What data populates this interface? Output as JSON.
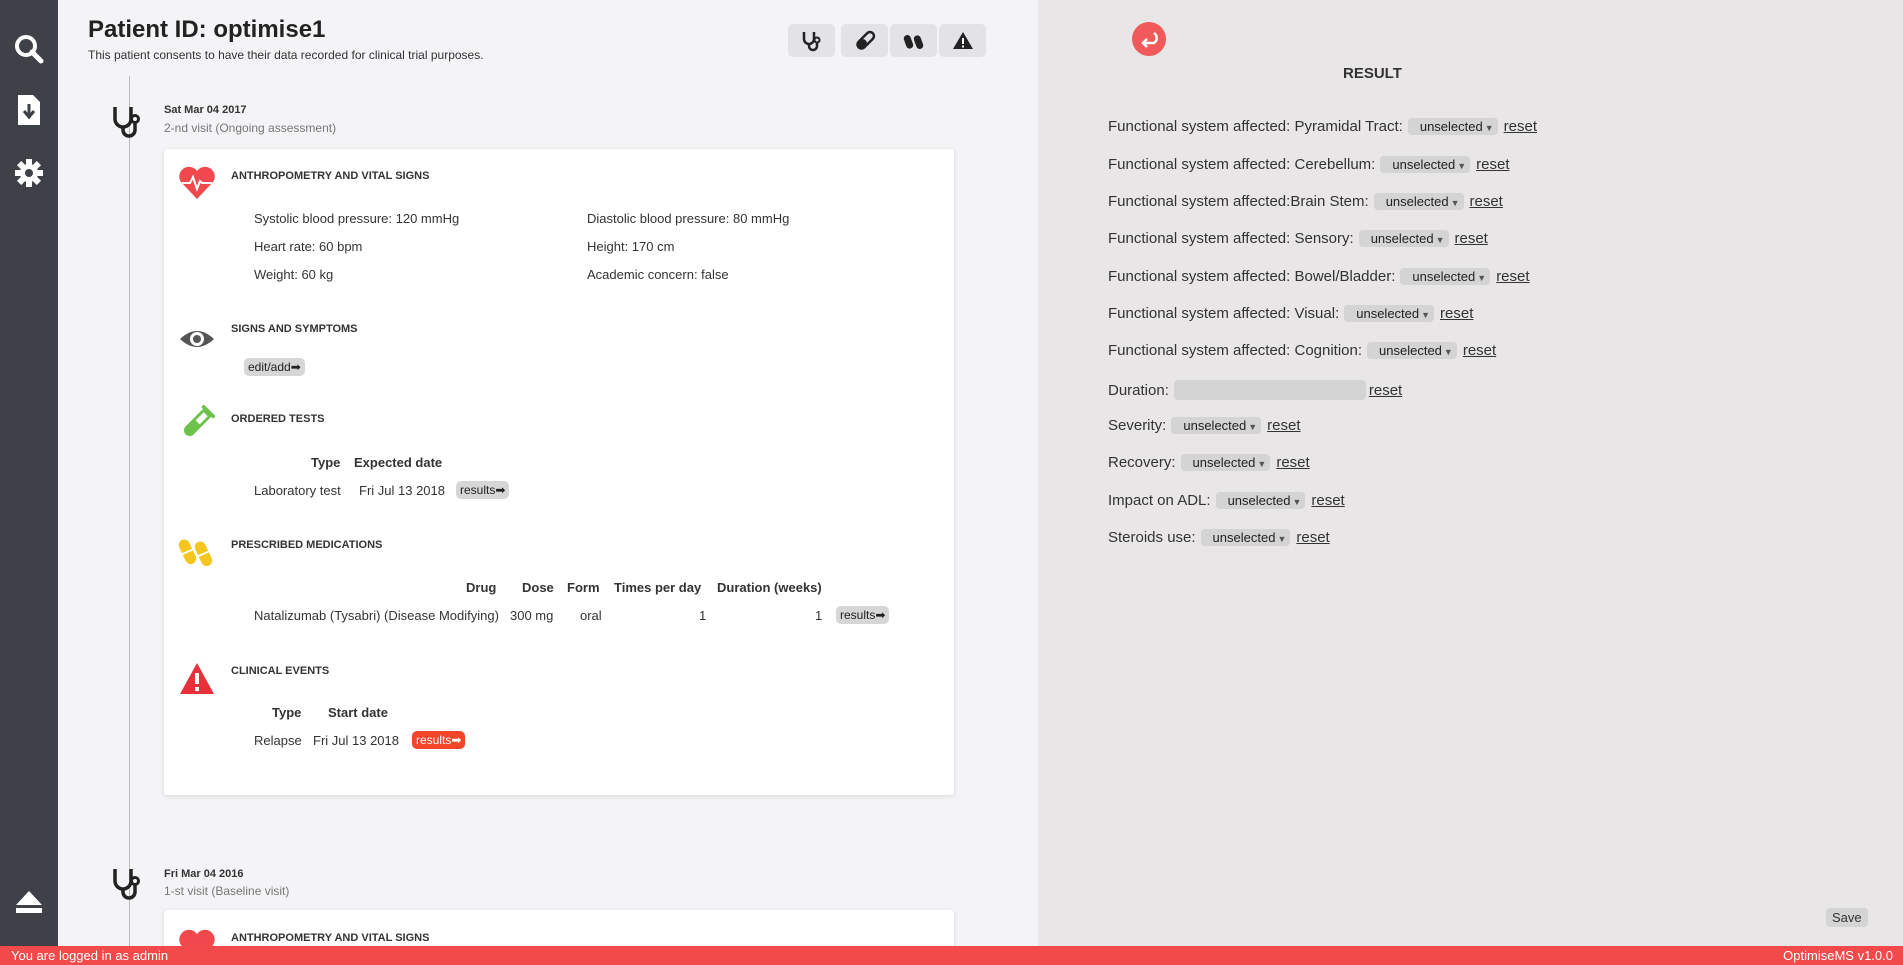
{
  "sidebar": {
    "icons": [
      "search-icon",
      "download-icon",
      "gear-icon",
      "eject-icon"
    ]
  },
  "header": {
    "patient_label": "Patient ID:",
    "patient_id": "optimise1",
    "consent": "This patient consents to have their data recorded for clinical trial purposes."
  },
  "toolbar": {
    "icons": [
      "stethoscope-icon",
      "test-tube-icon",
      "pills-icon",
      "warning-icon"
    ]
  },
  "visits": [
    {
      "date": "Sat Mar 04 2017",
      "type": "2-nd visit (Ongoing assessment)",
      "vitals": {
        "title": "ANTHROPOMETRY AND VITAL SIGNS",
        "systolic": "Systolic blood pressure: 120 mmHg",
        "diastolic": "Diastolic blood pressure: 80 mmHg",
        "heart_rate": "Heart rate: 60 bpm",
        "height": "Height: 170 cm",
        "weight": "Weight: 60 kg",
        "academic": "Academic concern: false"
      },
      "symptoms": {
        "title": "SIGNS AND SYMPTOMS",
        "edit_label": "edit/add➡"
      },
      "tests": {
        "title": "ORDERED TESTS",
        "headers": [
          "Type",
          "Expected date"
        ],
        "rows": [
          [
            "Laboratory test",
            "Fri Jul 13 2018",
            "results➡"
          ]
        ]
      },
      "medications": {
        "title": "PRESCRIBED MEDICATIONS",
        "headers": [
          "Drug",
          "Dose",
          "Form",
          "Times per day",
          "Duration (weeks)"
        ],
        "rows": [
          [
            "Natalizumab (Tysabri) (Disease Modifying)",
            "300 mg",
            "oral",
            "1",
            "1",
            "results➡"
          ]
        ]
      },
      "events": {
        "title": "CLINICAL EVENTS",
        "headers": [
          "Type",
          "Start date"
        ],
        "rows": [
          [
            "Relapse",
            "Fri Jul 13 2018",
            "results➡"
          ]
        ]
      }
    },
    {
      "date": "Fri Mar 04 2016",
      "type": "1-st visit (Baseline visit)",
      "vitals_title": "ANTHROPOMETRY AND VITAL SIGNS"
    }
  ],
  "result": {
    "title": "RESULT",
    "rows": [
      {
        "label": "Functional system affected: Pyramidal Tract:",
        "value": "unselected",
        "reset": "reset"
      },
      {
        "label": "Functional system affected: Cerebellum:",
        "value": "unselected",
        "reset": "reset"
      },
      {
        "label": "Functional system affected:Brain Stem:",
        "value": "unselected",
        "reset": "reset"
      },
      {
        "label": "Functional system affected: Sensory:",
        "value": "unselected",
        "reset": "reset"
      },
      {
        "label": "Functional system affected: Bowel/Bladder:",
        "value": "unselected",
        "reset": "reset"
      },
      {
        "label": "Functional system affected: Visual:",
        "value": "unselected",
        "reset": "reset"
      },
      {
        "label": "Functional system affected: Cognition:",
        "value": "unselected",
        "reset": "reset"
      },
      {
        "label": "Duration:",
        "value": "",
        "reset": "reset"
      },
      {
        "label": "Severity:",
        "value": "unselected",
        "reset": "reset"
      },
      {
        "label": "Recovery:",
        "value": "unselected",
        "reset": "reset"
      },
      {
        "label": "Impact on ADL:",
        "value": "unselected",
        "reset": "reset"
      },
      {
        "label": "Steroids use:",
        "value": "unselected",
        "reset": "reset"
      }
    ],
    "save_label": "Save"
  },
  "statusbar": {
    "login": "You are logged in as admin",
    "version": "OptimiseMS v1.0.0"
  },
  "colors": {
    "sidebar": "#3f4148",
    "accent_red": "#f24a4a",
    "heart": "#f0484c",
    "tube": "#6cc24a",
    "pills": "#f4c61e",
    "event": "#e8303a"
  }
}
